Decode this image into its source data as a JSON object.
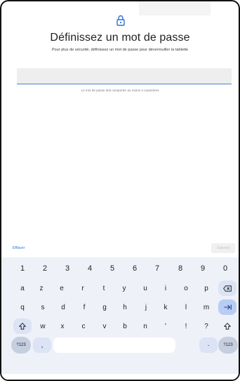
{
  "page": {
    "title": "Définissez un mot de passe",
    "subtitle": "Pour plus de sécurité, définissez un mot de passe pour déverrouiller la tablette",
    "password_value": "",
    "hint": "Le mot de passe doit comporter au moins 4 caractères",
    "clear_label": "Effacer",
    "next_label": "Suivant"
  },
  "colors": {
    "accent": "#2f6fd1",
    "keyboard_bg": "#eef1f8",
    "field_bg": "#eeeeee"
  },
  "icons": {
    "lock": "lock-icon",
    "shift": "shift-icon",
    "backspace": "backspace-icon",
    "tab": "tab-icon"
  },
  "keyboard": {
    "digits": [
      "1",
      "2",
      "3",
      "4",
      "5",
      "6",
      "7",
      "8",
      "9",
      "0"
    ],
    "row1": [
      "a",
      "z",
      "e",
      "r",
      "t",
      "y",
      "u",
      "i",
      "o",
      "p"
    ],
    "row2": [
      "q",
      "s",
      "d",
      "f",
      "g",
      "h",
      "j",
      "k",
      "l",
      "m"
    ],
    "row3": [
      "w",
      "x",
      "c",
      "v",
      "b",
      "n",
      "'",
      "!",
      "?"
    ],
    "symbols_left": "?123",
    "symbols_right": "?123",
    "comma": ",",
    "period": "·"
  }
}
